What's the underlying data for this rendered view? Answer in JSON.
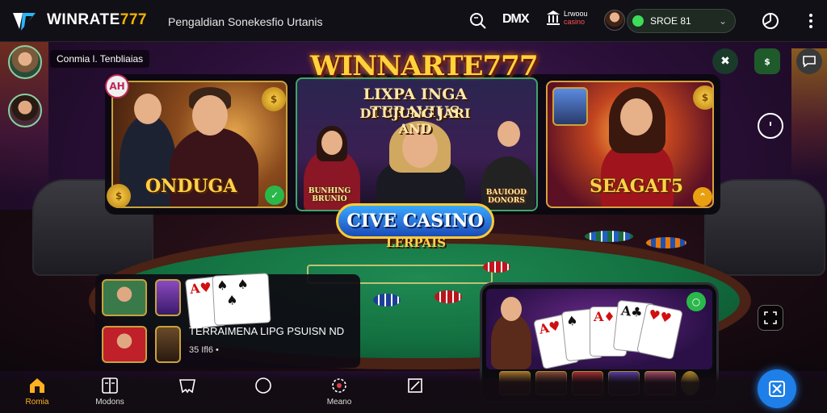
{
  "header": {
    "logo_mark": "V",
    "brand_prefix": "WINRATE",
    "brand_suffix": "777",
    "tagline": "Pengaldian Sonekesfio Urtanis",
    "dmx_label": "DMX",
    "casino_badge_line1": "Lrwoou",
    "casino_badge_line2": "casino",
    "balance": "SROE 81",
    "balance_dot_color": "#3ddc5a"
  },
  "community": {
    "label": "Conmia l. Tenbliaias"
  },
  "banner": {
    "hero_title": "WINNARTE777",
    "hero_sub1": "LIXPA INGA TERAVIUS",
    "hero_sub2": "DI UJUNG JARI AND",
    "card_left_badge": "AH",
    "card_left_title": "ONDUGA",
    "card_center_left_caption": "BUNHING BRUNIO",
    "card_center_right_caption": "BAUIOOD DONORS",
    "card_right_title": "SEAGAT5",
    "live_title": "CIVE CASINO",
    "live_sub": "LERPAIS"
  },
  "info_panel": {
    "title": "TERRAIMENA LIPG PSUISN ND",
    "meta": "35 Ifl6 •",
    "card_rank": "A"
  },
  "bottom_nav": {
    "items": [
      {
        "label": "Romia",
        "icon": "home-icon"
      },
      {
        "label": "Modons",
        "icon": "book-icon"
      },
      {
        "label": "",
        "icon": "tooth-icon"
      },
      {
        "label": "",
        "icon": "circle-icon"
      },
      {
        "label": "Meano",
        "icon": "settings-icon"
      },
      {
        "label": "",
        "icon": "edit-icon"
      }
    ]
  },
  "colors": {
    "accent_gold": "#ffd33a",
    "accent_blue": "#1e7fe8",
    "nav_active": "#ffb020",
    "table_green": "#137040"
  }
}
